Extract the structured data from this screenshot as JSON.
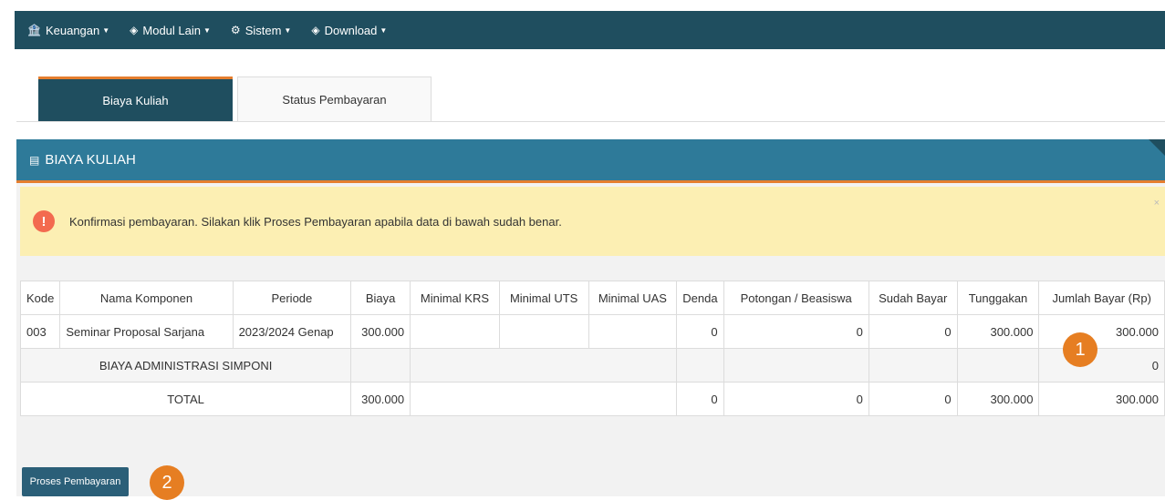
{
  "nav": [
    {
      "label": "Keuangan",
      "icon": "money-icon",
      "glyph": "🏦"
    },
    {
      "label": "Modul Lain",
      "icon": "layers-icon",
      "glyph": "◈"
    },
    {
      "label": "Sistem",
      "icon": "gear-icon",
      "glyph": "⚙"
    },
    {
      "label": "Download",
      "icon": "layers-icon",
      "glyph": "◈"
    }
  ],
  "tabs": {
    "active": "Biaya Kuliah",
    "inactive": "Status Pembayaran"
  },
  "panel": {
    "title": "BIAYA KULIAH",
    "close": "×"
  },
  "alert": {
    "text": "Konfirmasi pembayaran. Silakan klik Proses Pembayaran apabila data di bawah sudah benar.",
    "icon": "!"
  },
  "table": {
    "headers": [
      "Kode",
      "Nama Komponen",
      "Periode",
      "Biaya",
      "Minimal KRS",
      "Minimal UTS",
      "Minimal UAS",
      "Denda",
      "Potongan / Beasiswa",
      "Sudah Bayar",
      "Tunggakan",
      "Jumlah Bayar (Rp)"
    ],
    "row1": {
      "kode": "003",
      "nama": "Seminar Proposal Sarjana",
      "periode": "2023/2024 Genap",
      "biaya": "300.000",
      "min_krs": "",
      "min_uts": "",
      "min_uas": "",
      "denda": "0",
      "potongan": "0",
      "sudah_bayar": "0",
      "tunggakan": "300.000",
      "jumlah": "300.000"
    },
    "admin": {
      "label": "BIAYA ADMINISTRASI SIMPONI",
      "jumlah": "0"
    },
    "total": {
      "label": "TOTAL",
      "biaya": "300.000",
      "denda": "0",
      "potongan": "0",
      "sudah_bayar": "0",
      "tunggakan": "300.000",
      "jumlah": "300.000"
    }
  },
  "button": {
    "label": "Proses Pembayaran"
  },
  "badges": {
    "one": "1",
    "two": "2"
  },
  "colors": {
    "nav": "#1f4e5f",
    "header": "#2e7a99",
    "accent": "#e57e2f",
    "alert_bg": "#fcefb3"
  }
}
